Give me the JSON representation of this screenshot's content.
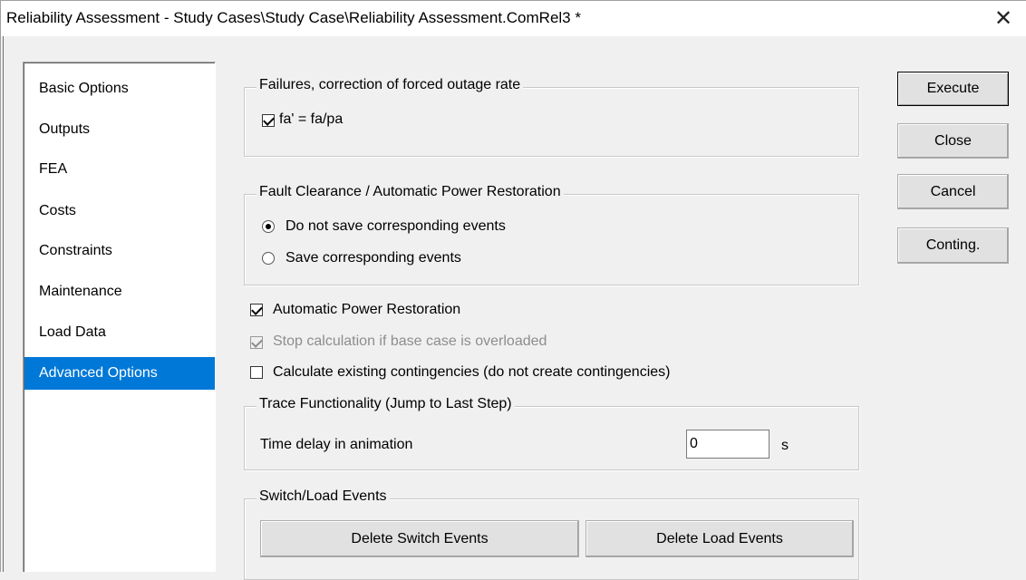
{
  "window": {
    "title": "Reliability Assessment - Study Cases\\Study Case\\Reliability Assessment.ComRel3 *",
    "close_glyph": "✕"
  },
  "nav": {
    "items": [
      {
        "label": "Basic Options",
        "selected": false
      },
      {
        "label": "Outputs",
        "selected": false
      },
      {
        "label": "FEA",
        "selected": false
      },
      {
        "label": "Costs",
        "selected": false
      },
      {
        "label": "Constraints",
        "selected": false
      },
      {
        "label": "Maintenance",
        "selected": false
      },
      {
        "label": "Load Data",
        "selected": false
      },
      {
        "label": "Advanced Options",
        "selected": true
      }
    ],
    "selected_color": "#0078d7"
  },
  "failures": {
    "title": "Failures, correction of forced outage rate",
    "fa_label": "fa' = fa/pa",
    "fa_checked": true
  },
  "fault_clearance": {
    "title": "Fault Clearance / Automatic Power Restoration",
    "option_no_save": "Do not save corresponding events",
    "option_save": "Save corresponding events",
    "selected": "no_save"
  },
  "options": {
    "auto_restoration_label": "Automatic Power Restoration",
    "auto_restoration_checked": true,
    "stop_calc_label": "Stop calculation if base case is overloaded",
    "stop_calc_checked": true,
    "stop_calc_enabled": false,
    "calc_existing_label": "Calculate existing contingencies (do not create contingencies)",
    "calc_existing_checked": false
  },
  "trace": {
    "title": "Trace Functionality (Jump to Last Step)",
    "delay_label": "Time delay in animation",
    "delay_value": "0",
    "delay_unit": "s"
  },
  "events": {
    "title": "Switch/Load Events",
    "delete_switch_label": "Delete Switch Events",
    "delete_load_label": "Delete Load Events"
  },
  "actions": {
    "execute_label": "Execute",
    "close_label": "Close",
    "cancel_label": "Cancel",
    "conting_label": "Conting."
  }
}
